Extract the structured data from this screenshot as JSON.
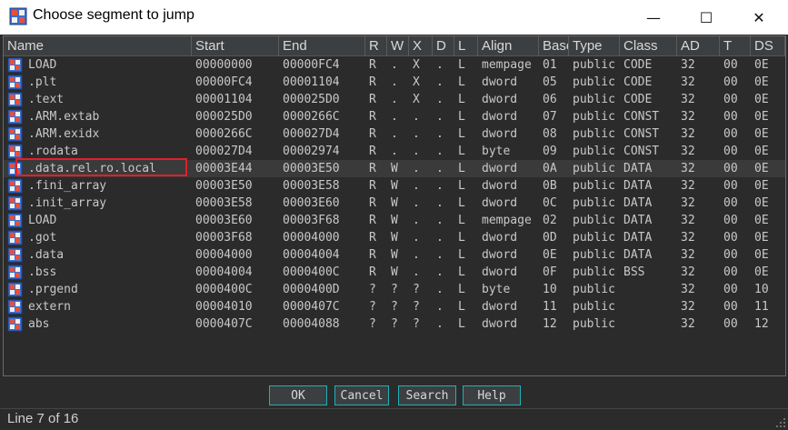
{
  "window": {
    "title": "Choose segment to jump",
    "minimize_glyph": "—",
    "maximize_glyph": "☐",
    "close_glyph": "✕"
  },
  "table": {
    "columns": [
      "Name",
      "Start",
      "End",
      "R",
      "W",
      "X",
      "D",
      "L",
      "Align",
      "Base",
      "Type",
      "Class",
      "AD",
      "T",
      "DS"
    ],
    "rows": [
      [
        "LOAD",
        "00000000",
        "00000FC4",
        "R",
        ".",
        "X",
        ".",
        "L",
        "mempage",
        "01",
        "public",
        "CODE",
        "32",
        "00",
        "0E"
      ],
      [
        ".plt",
        "00000FC4",
        "00001104",
        "R",
        ".",
        "X",
        ".",
        "L",
        "dword",
        "05",
        "public",
        "CODE",
        "32",
        "00",
        "0E"
      ],
      [
        ".text",
        "00001104",
        "000025D0",
        "R",
        ".",
        "X",
        ".",
        "L",
        "dword",
        "06",
        "public",
        "CODE",
        "32",
        "00",
        "0E"
      ],
      [
        ".ARM.extab",
        "000025D0",
        "0000266C",
        "R",
        ".",
        ".",
        ".",
        "L",
        "dword",
        "07",
        "public",
        "CONST",
        "32",
        "00",
        "0E"
      ],
      [
        ".ARM.exidx",
        "0000266C",
        "000027D4",
        "R",
        ".",
        ".",
        ".",
        "L",
        "dword",
        "08",
        "public",
        "CONST",
        "32",
        "00",
        "0E"
      ],
      [
        ".rodata",
        "000027D4",
        "00002974",
        "R",
        ".",
        ".",
        ".",
        "L",
        "byte",
        "09",
        "public",
        "CONST",
        "32",
        "00",
        "0E"
      ],
      [
        ".data.rel.ro.local",
        "00003E44",
        "00003E50",
        "R",
        "W",
        ".",
        ".",
        "L",
        "dword",
        "0A",
        "public",
        "DATA",
        "32",
        "00",
        "0E"
      ],
      [
        ".fini_array",
        "00003E50",
        "00003E58",
        "R",
        "W",
        ".",
        ".",
        "L",
        "dword",
        "0B",
        "public",
        "DATA",
        "32",
        "00",
        "0E"
      ],
      [
        ".init_array",
        "00003E58",
        "00003E60",
        "R",
        "W",
        ".",
        ".",
        "L",
        "dword",
        "0C",
        "public",
        "DATA",
        "32",
        "00",
        "0E"
      ],
      [
        "LOAD",
        "00003E60",
        "00003F68",
        "R",
        "W",
        ".",
        ".",
        "L",
        "mempage",
        "02",
        "public",
        "DATA",
        "32",
        "00",
        "0E"
      ],
      [
        ".got",
        "00003F68",
        "00004000",
        "R",
        "W",
        ".",
        ".",
        "L",
        "dword",
        "0D",
        "public",
        "DATA",
        "32",
        "00",
        "0E"
      ],
      [
        ".data",
        "00004000",
        "00004004",
        "R",
        "W",
        ".",
        ".",
        "L",
        "dword",
        "0E",
        "public",
        "DATA",
        "32",
        "00",
        "0E"
      ],
      [
        ".bss",
        "00004004",
        "0000400C",
        "R",
        "W",
        ".",
        ".",
        "L",
        "dword",
        "0F",
        "public",
        "BSS",
        "32",
        "00",
        "0E"
      ],
      [
        ".prgend",
        "0000400C",
        "0000400D",
        "?",
        "?",
        "?",
        ".",
        "L",
        "byte",
        "10",
        "public",
        "",
        "32",
        "00",
        "10"
      ],
      [
        "extern",
        "00004010",
        "0000407C",
        "?",
        "?",
        "?",
        ".",
        "L",
        "dword",
        "11",
        "public",
        "",
        "32",
        "00",
        "11"
      ],
      [
        "abs",
        "0000407C",
        "00004088",
        "?",
        "?",
        "?",
        ".",
        "L",
        "dword",
        "12",
        "public",
        "",
        "32",
        "00",
        "12"
      ]
    ],
    "selected_index": 6
  },
  "buttons": {
    "ok": "OK",
    "cancel": "Cancel",
    "search": "Search",
    "help": "Help"
  },
  "status": {
    "text": "Line 7 of 16"
  },
  "colors": {
    "accent_border": "#20b0b8",
    "highlight_box": "#e0202a",
    "background": "#2b2b2b"
  },
  "icons": {
    "app": "segment-grid-icon",
    "row": "segment-grid-icon"
  }
}
